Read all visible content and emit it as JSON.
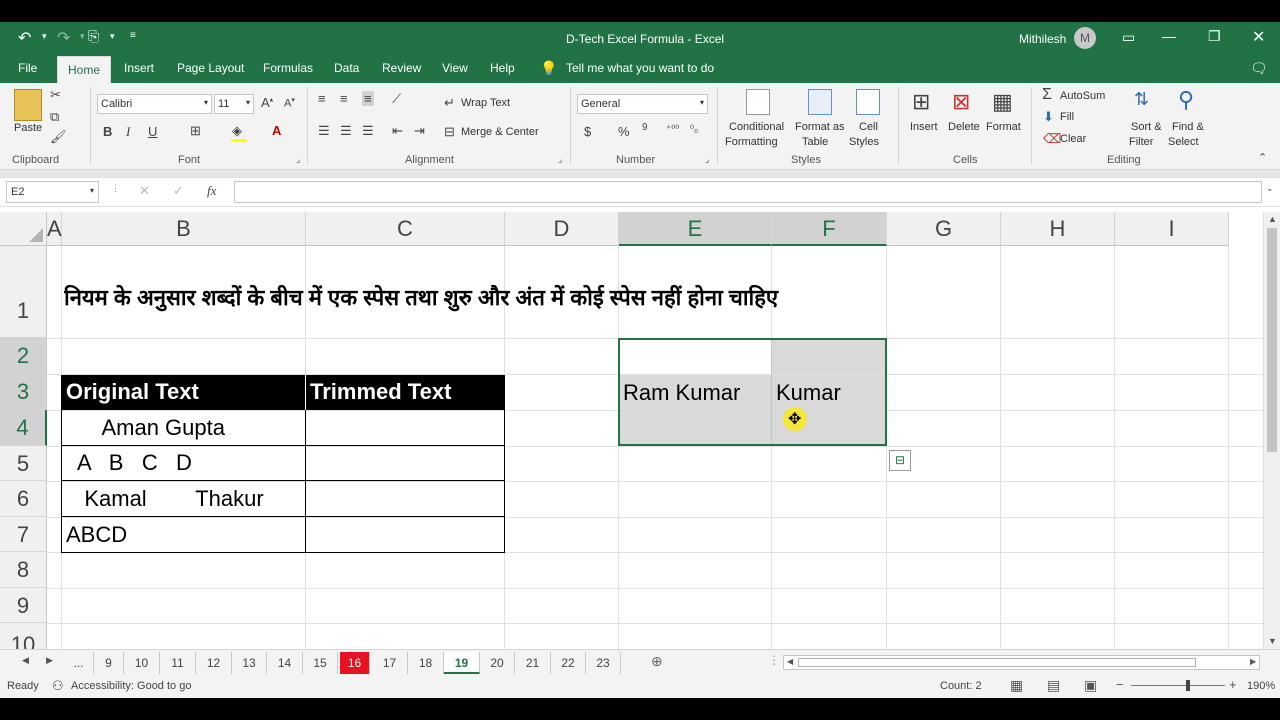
{
  "titlebar": {
    "title": "D-Tech Excel Formula  -  Excel",
    "user": "Mithilesh",
    "avatar": "M"
  },
  "tabs": [
    "File",
    "Home",
    "Insert",
    "Page Layout",
    "Formulas",
    "Data",
    "Review",
    "View",
    "Help"
  ],
  "tell_me": "Tell me what you want to do",
  "ribbon": {
    "clipboard": {
      "paste": "Paste",
      "group": "Clipboard"
    },
    "font": {
      "name": "Calibri",
      "size": "11",
      "bold": "B",
      "italic": "I",
      "underline": "U",
      "group": "Font"
    },
    "alignment": {
      "wrap": "Wrap Text",
      "merge": "Merge & Center",
      "group": "Alignment"
    },
    "number": {
      "format": "General",
      "dollar": "$",
      "percent": "%",
      "comma": "9",
      "group": "Number"
    },
    "styles": {
      "cond1": "Conditional",
      "cond2": "Formatting",
      "fmt1": "Format as",
      "fmt2": "Table",
      "cell1": "Cell",
      "cell2": "Styles",
      "group": "Styles"
    },
    "cells": {
      "insert": "Insert",
      "delete": "Delete",
      "format": "Format",
      "group": "Cells"
    },
    "editing": {
      "autosum": "AutoSum",
      "fill": "Fill",
      "clear": "Clear",
      "sort1": "Sort &",
      "sort2": "Filter",
      "find1": "Find &",
      "find2": "Select",
      "group": "Editing"
    }
  },
  "formula_bar": {
    "name_box": "E2",
    "fx": "fx",
    "value": ""
  },
  "columns": [
    "A",
    "B",
    "C",
    "D",
    "E",
    "F",
    "G",
    "H",
    "I"
  ],
  "rows": [
    "1",
    "2",
    "3",
    "4",
    "5",
    "6",
    "7",
    "8",
    "9",
    "10"
  ],
  "cells": {
    "B1": "नियम के अनुसार शब्दों के बीच में एक स्पेस तथा शुरु और अंत में कोई स्पेस नहीं होना चाहिए",
    "B3": "Original Text",
    "C3": "Trimmed Text",
    "B4": "      Aman Gupta",
    "B5": "  A   B   C   D",
    "B6": "   Kamal        Thakur",
    "B7": "ABCD",
    "E3": "Ram Kumar",
    "F3": "Kumar"
  },
  "sheet_tabs": [
    "...",
    "9",
    "10",
    "11",
    "12",
    "13",
    "14",
    "15",
    "16",
    "17",
    "18",
    "19",
    "20",
    "21",
    "22",
    "23"
  ],
  "status": {
    "ready": "Ready",
    "accessibility": "Accessibility: Good to go",
    "count": "Count: 2",
    "zoom": "190%"
  },
  "colors": {
    "excel_green": "#217346",
    "header_black": "#000000",
    "tab_red": "#e81123",
    "selection_gray": "#d9d9d9"
  }
}
